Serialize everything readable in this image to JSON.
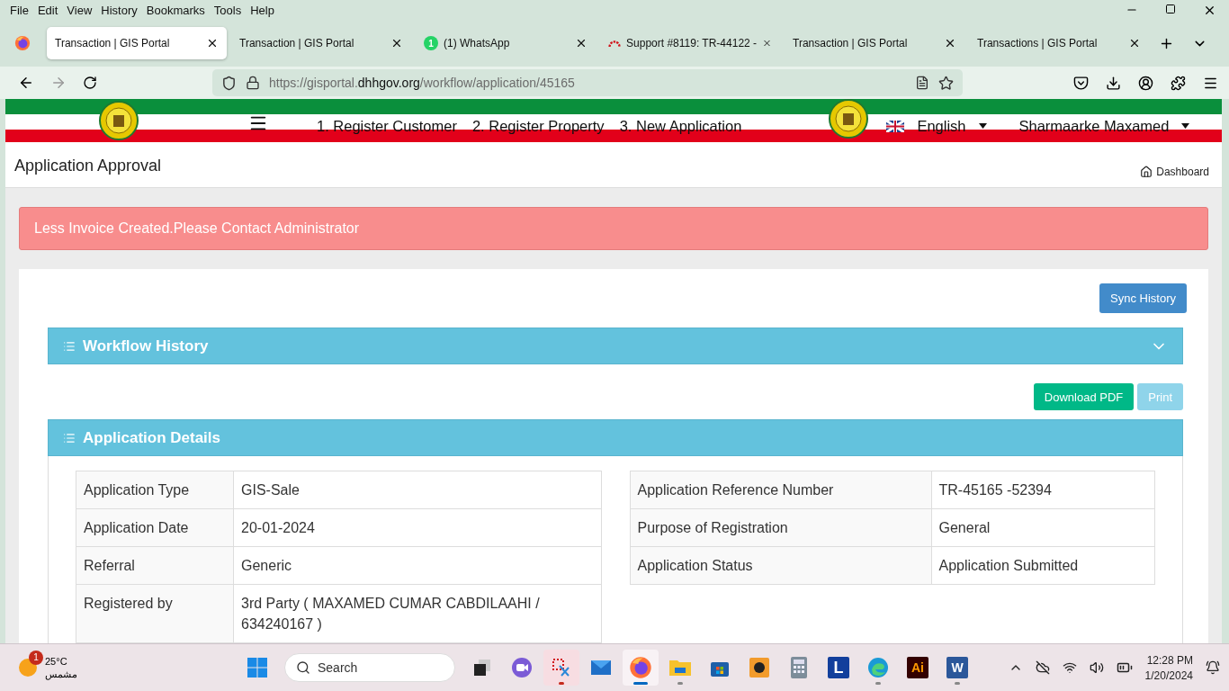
{
  "menu_bar": [
    "File",
    "Edit",
    "View",
    "History",
    "Bookmarks",
    "Tools",
    "Help"
  ],
  "tabs": [
    {
      "title": "Transaction | GIS Portal",
      "kind": "plain",
      "selected": true
    },
    {
      "title": "Transaction | GIS Portal",
      "kind": "plain",
      "selected": false
    },
    {
      "title": "(1) WhatsApp",
      "kind": "chat",
      "badge": "1",
      "selected": false
    },
    {
      "title": "Support #8119: TR-44122 -",
      "kind": "gauge",
      "selected": false
    },
    {
      "title": "Transaction | GIS Portal",
      "kind": "plain",
      "selected": false
    },
    {
      "title": "Transactions | GIS Portal",
      "kind": "plain",
      "selected": false
    }
  ],
  "address": {
    "prefix": "https://gisportal.",
    "domain": "dhhgov.org",
    "path": "/workflow/application/45165"
  },
  "site_nav": {
    "items": [
      "1. Register Customer",
      "2. Register Property",
      "3. New Application"
    ],
    "language": "English",
    "user": "Sharmaarke Maxamed"
  },
  "page_header": {
    "title": "Application Approval",
    "breadcrumb": "Dashboard"
  },
  "alert": "Less Invoice Created.Please Contact Administrator",
  "sync_button": "Sync History",
  "workflow_panel": {
    "title": "Workflow History",
    "expanded": false
  },
  "actions": [
    {
      "label": "Download PDF",
      "disabled": false
    },
    {
      "label": "Print",
      "disabled": true
    }
  ],
  "details": {
    "title": "Application Details",
    "left_rows": [
      {
        "label": "Application Type",
        "value": "GIS-Sale"
      },
      {
        "label": "Application Date",
        "value": "20-01-2024"
      },
      {
        "label": "Referral",
        "value": "Generic"
      },
      {
        "label": "Registered by",
        "value": "3rd Party ( MAXAMED CUMAR CABDILAAHI / 634240167 )"
      }
    ],
    "right_rows": [
      {
        "label": "Application Reference Number",
        "value": "TR-45165 -52394"
      },
      {
        "label": "Purpose of Registration",
        "value": "General"
      },
      {
        "label": "Application Status",
        "value": "Application Submitted"
      }
    ]
  },
  "taskbar": {
    "weather": {
      "badge": "1",
      "temperature": "25°C",
      "condition": "مشمس"
    },
    "search": "Search",
    "apps": [
      {
        "kind": "start",
        "running": false,
        "selected": false,
        "attention": false
      },
      {
        "kind": "taskview",
        "running": false,
        "selected": false,
        "attention": false
      },
      {
        "kind": "meet",
        "running": false,
        "selected": false,
        "attention": false
      },
      {
        "kind": "snip",
        "running": true,
        "selected": false,
        "attention": true
      },
      {
        "kind": "mail",
        "running": false,
        "selected": false,
        "attention": false
      },
      {
        "kind": "firefox",
        "running": true,
        "selected": true,
        "attention": false
      },
      {
        "kind": "folder",
        "running": true,
        "selected": false,
        "attention": false
      },
      {
        "kind": "store",
        "running": false,
        "selected": false,
        "attention": false
      },
      {
        "kind": "orange",
        "running": false,
        "selected": false,
        "attention": false
      },
      {
        "kind": "calculator",
        "running": false,
        "selected": false,
        "attention": false
      },
      {
        "kind": "letter",
        "label": "L",
        "running": false,
        "selected": false,
        "attention": false
      },
      {
        "kind": "edge",
        "running": true,
        "selected": false,
        "attention": false
      },
      {
        "kind": "letter_dark",
        "label": "Ai",
        "running": false,
        "selected": false,
        "attention": false
      },
      {
        "kind": "word",
        "label": "W",
        "running": true,
        "selected": false,
        "attention": false
      }
    ],
    "time": "12:28 PM",
    "date": "1/20/2024"
  }
}
